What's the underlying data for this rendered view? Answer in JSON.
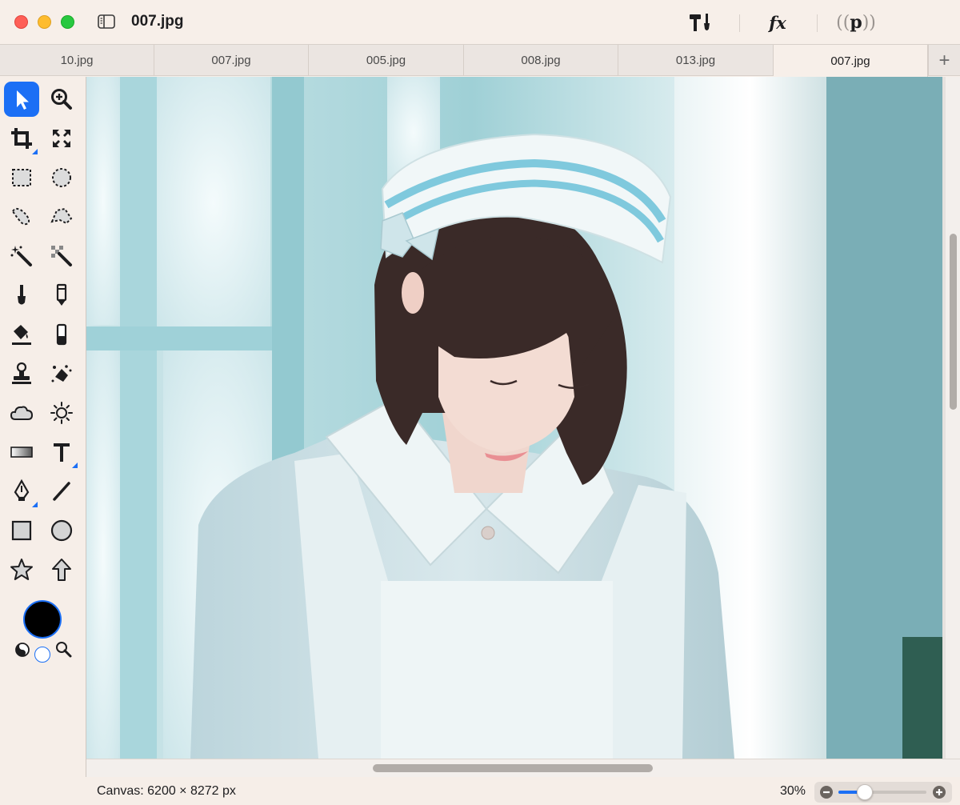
{
  "window": {
    "title": "007.jpg"
  },
  "toolbar": {
    "tools_icon": "hammer-brush-icon",
    "fx_label": "fx",
    "p_label": "p",
    "p_bracket_left": "(",
    "p_bracket_right": ")"
  },
  "tabs": [
    {
      "label": "10.jpg",
      "active": false
    },
    {
      "label": "007.jpg",
      "active": false
    },
    {
      "label": "005.jpg",
      "active": false
    },
    {
      "label": "008.jpg",
      "active": false
    },
    {
      "label": "013.jpg",
      "active": false
    },
    {
      "label": "007.jpg",
      "active": true
    }
  ],
  "tab_add_label": "+",
  "tools": [
    {
      "name": "arrow-select-tool",
      "selected": true
    },
    {
      "name": "zoom-tool",
      "selected": false
    },
    {
      "name": "crop-tool",
      "selected": false
    },
    {
      "name": "transform-tool",
      "selected": false
    },
    {
      "name": "rect-select-tool",
      "selected": false
    },
    {
      "name": "ellipse-select-tool",
      "selected": false
    },
    {
      "name": "lasso-tool",
      "selected": false
    },
    {
      "name": "polygon-lasso-tool",
      "selected": false
    },
    {
      "name": "magic-wand-tool",
      "selected": false
    },
    {
      "name": "color-select-tool",
      "selected": false
    },
    {
      "name": "brush-tool",
      "selected": false
    },
    {
      "name": "pencil-tool",
      "selected": false
    },
    {
      "name": "fill-tool",
      "selected": false
    },
    {
      "name": "eraser-tool",
      "selected": false
    },
    {
      "name": "clone-stamp-tool",
      "selected": false
    },
    {
      "name": "smudge-tool",
      "selected": false
    },
    {
      "name": "cloud-tool",
      "selected": false
    },
    {
      "name": "light-tool",
      "selected": false
    },
    {
      "name": "gradient-tool",
      "selected": false
    },
    {
      "name": "text-tool",
      "selected": false
    },
    {
      "name": "pen-tool",
      "selected": false
    },
    {
      "name": "line-tool",
      "selected": false
    },
    {
      "name": "rectangle-shape-tool",
      "selected": false
    },
    {
      "name": "ellipse-shape-tool",
      "selected": false
    },
    {
      "name": "star-shape-tool",
      "selected": false
    },
    {
      "name": "arrow-shape-tool",
      "selected": false
    }
  ],
  "colors": {
    "foreground": "#000000",
    "background": "#ffffff",
    "accent": "#1b6ff5"
  },
  "status": {
    "canvas_info": "Canvas: 6200 × 8272 px",
    "zoom_label": "30%",
    "zoom_fraction": 0.3
  }
}
